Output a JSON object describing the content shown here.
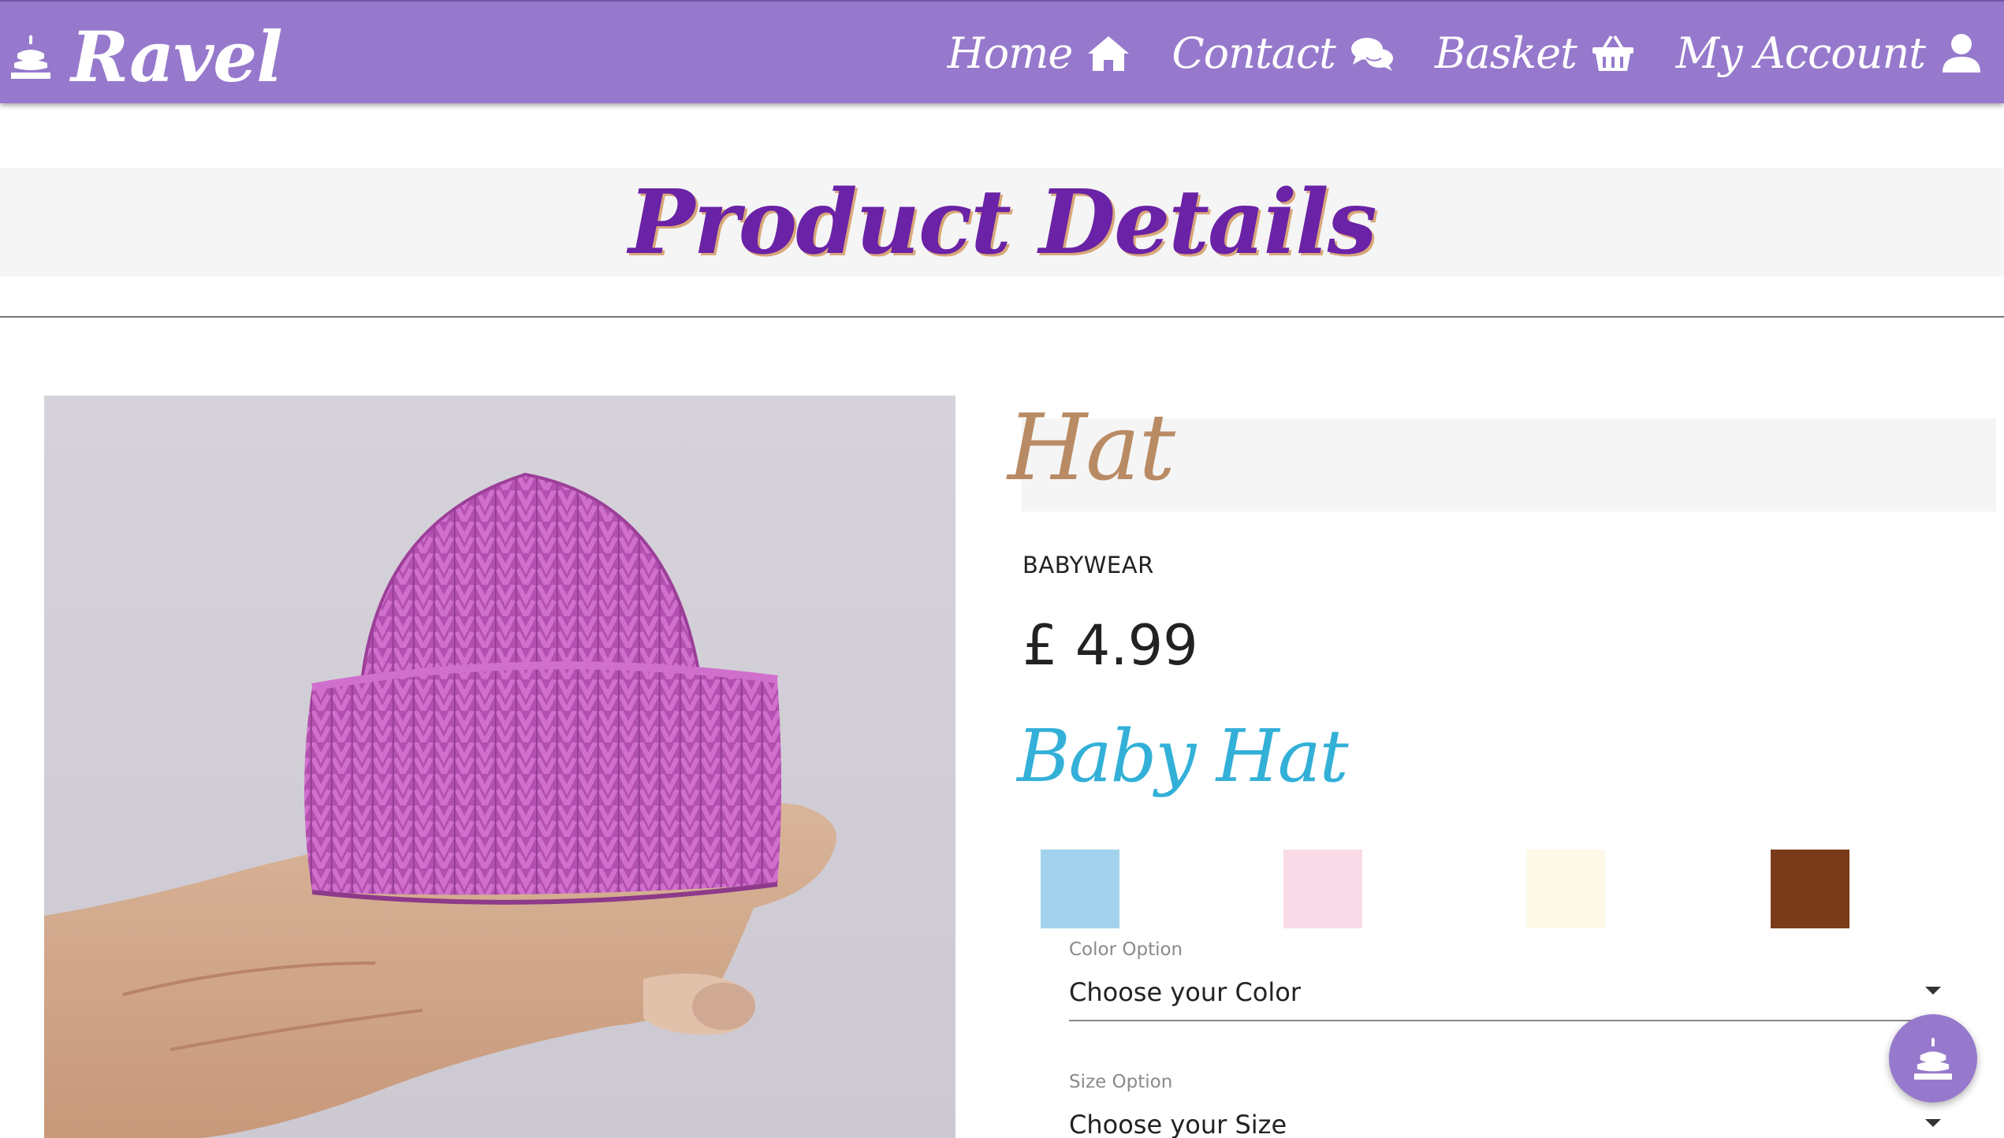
{
  "navbar": {
    "brand": "Ravel",
    "brand_icon": "cake-icon",
    "items": [
      {
        "label": "Home",
        "icon": "home-icon"
      },
      {
        "label": "Contact",
        "icon": "comments-icon"
      },
      {
        "label": "Basket",
        "icon": "basket-icon"
      },
      {
        "label": "My Account",
        "icon": "user-icon"
      }
    ],
    "color": "#9679cc"
  },
  "page": {
    "title": "Product Details",
    "title_color": "#6a22a6"
  },
  "product": {
    "name": "Hat",
    "category": "BABYWEAR",
    "price": "£ 4.99",
    "description": "Baby Hat",
    "colors": [
      "#a3d2ec",
      "#f9dbe7",
      "#fdf8e8",
      "#7a3b1a"
    ],
    "color_option": {
      "label": "Color Option",
      "value": "Choose your Color"
    },
    "size_option": {
      "label": "Size Option",
      "value": "Choose your Size"
    }
  },
  "fab": {
    "icon": "cake-icon"
  }
}
